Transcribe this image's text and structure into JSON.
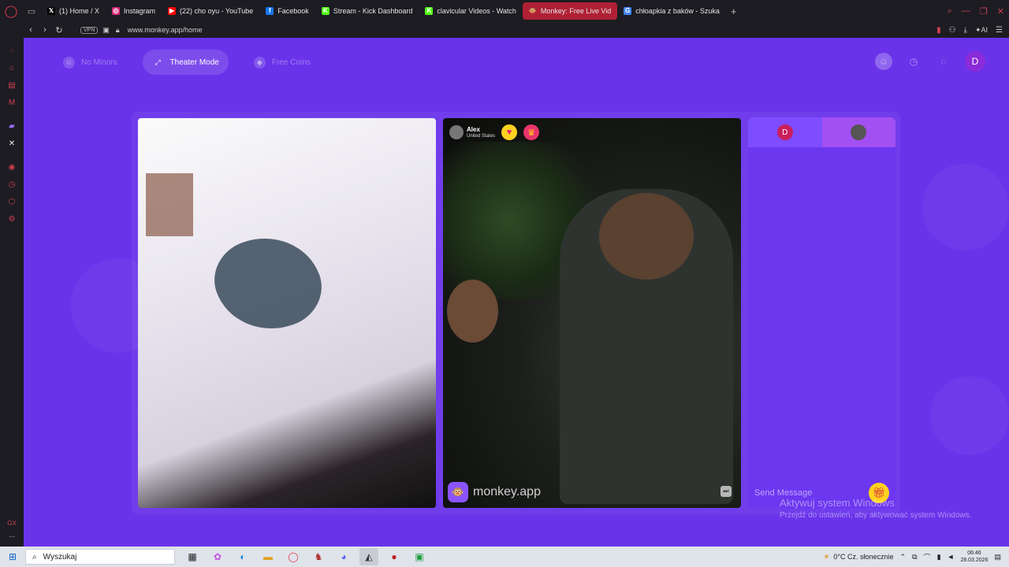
{
  "browser": {
    "tabs": [
      {
        "title": "(1) Home / X",
        "icon": "x-icon",
        "favicon": "𝕏",
        "color": "#000000",
        "active": false
      },
      {
        "title": "Instagram",
        "icon": "instagram-icon",
        "favicon": "◎",
        "color": "#d62976",
        "active": false
      },
      {
        "title": "(22) cho oyu - YouTube",
        "icon": "youtube-icon",
        "favicon": "▶",
        "color": "#ff0000",
        "active": false
      },
      {
        "title": "Facebook",
        "icon": "facebook-icon",
        "favicon": "f",
        "color": "#1877f2",
        "active": false
      },
      {
        "title": "Stream - Kick Dashboard",
        "icon": "kick-icon",
        "favicon": "K",
        "color": "#53fc18",
        "active": false
      },
      {
        "title": "clavicular Videos - Watch",
        "icon": "kick-icon",
        "favicon": "K",
        "color": "#53fc18",
        "active": false
      },
      {
        "title": "Monkey: Free Live Vid",
        "icon": "monkey-icon",
        "favicon": "🐵",
        "color": "#b02035",
        "active": true
      },
      {
        "title": "chłoapkia z baków - Szuka",
        "icon": "google-icon",
        "favicon": "G",
        "color": "#4285f4",
        "active": false
      }
    ],
    "new_tab": "+",
    "address": {
      "vpn": "VPN",
      "url": "www.monkey.app/home",
      "ai_label": "AI"
    }
  },
  "page": {
    "top_nav": [
      {
        "label": "No Minors",
        "icon": "no-minors-icon",
        "glyph": "☺",
        "active": false
      },
      {
        "label": "Theater Mode",
        "icon": "theater-mode-icon",
        "glyph": "⤢",
        "active": true
      },
      {
        "label": "Free Coins",
        "icon": "coins-icon",
        "glyph": "◆",
        "active": false
      }
    ],
    "user_initial": "D",
    "peer": {
      "name": "Alex",
      "country": "United States"
    },
    "brand": "monkey.app",
    "chat": {
      "me_initial": "D",
      "placeholder": "Send Message"
    }
  },
  "os": {
    "watermark_title": "Aktywuj system Windows",
    "watermark_sub": "Przejdź do ustawień, aby aktywować system Windows.",
    "search_placeholder": "Wyszukaj",
    "weather": "0°C  Cz. słonecznie",
    "time": "06:46",
    "date": "28.03.2026"
  }
}
